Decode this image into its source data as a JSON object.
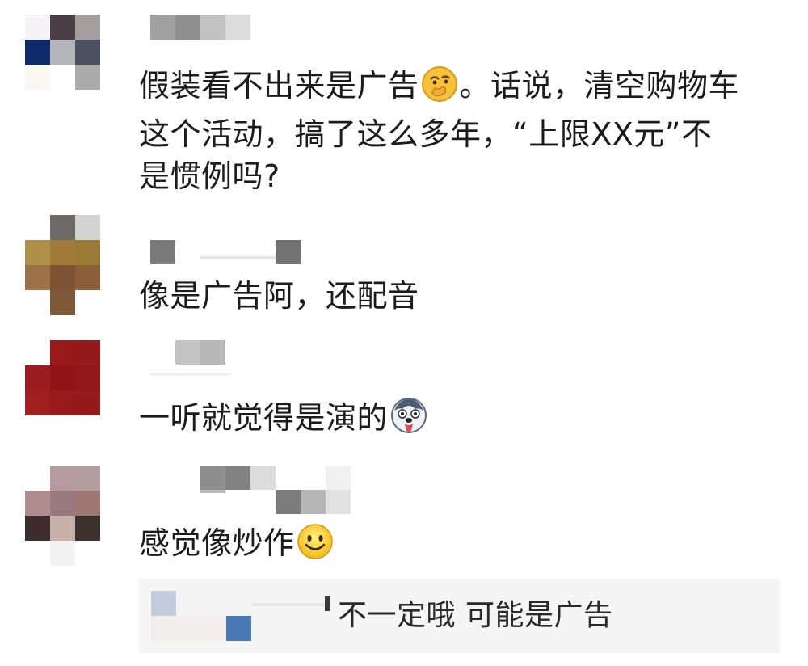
{
  "comments": [
    {
      "text_line1": "假装看不出来是广告",
      "text_line1_tail": "。话说，清空购物车",
      "text_line2": "这个活动，搞了这么多年，“上限XX元”不",
      "text_line3": "是惯例吗?",
      "emoji": "thinking-face-icon"
    },
    {
      "text": "像是广告阿，还配音"
    },
    {
      "text": "一听就觉得是演的",
      "emoji": "husky-dog-icon"
    },
    {
      "text": "感觉像炒作",
      "emoji": "smiling-face-icon"
    }
  ],
  "reply": {
    "text": "不一定哦 可能是广告"
  }
}
